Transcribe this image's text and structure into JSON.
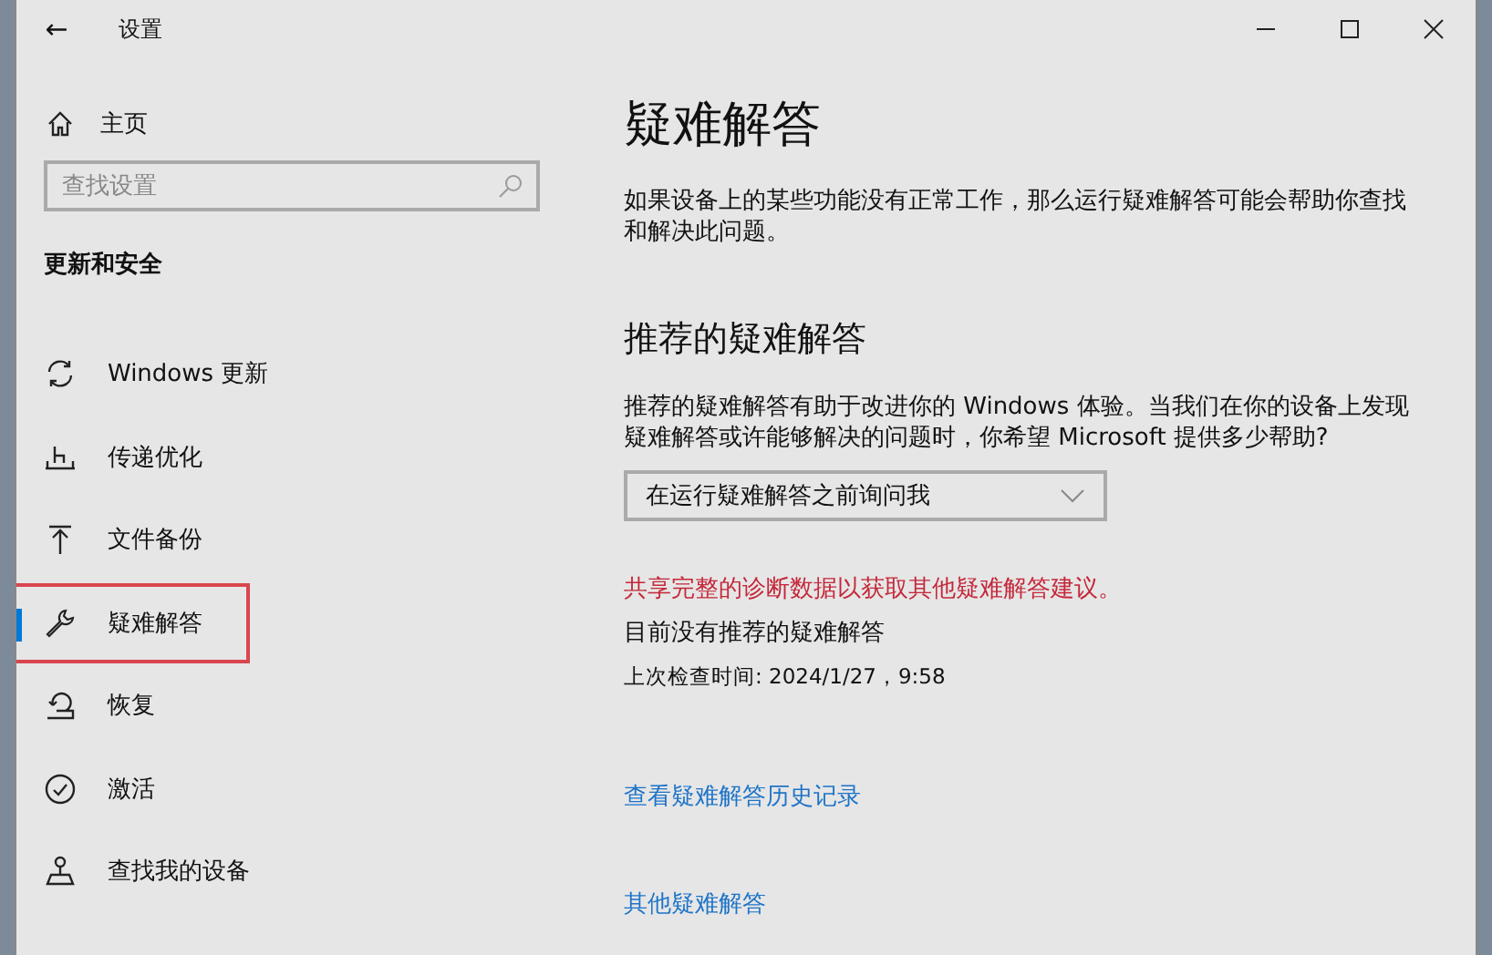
{
  "window": {
    "title": "设置",
    "back_button": "←"
  },
  "sidebar": {
    "home": "主页",
    "search": {
      "placeholder": "查找设置"
    },
    "section": "更新和安全",
    "items": [
      {
        "label": "Windows 更新",
        "selected": false,
        "highlighted": false
      },
      {
        "label": "传递优化",
        "selected": false,
        "highlighted": false
      },
      {
        "label": "文件备份",
        "selected": false,
        "highlighted": false
      },
      {
        "label": "疑难解答",
        "selected": true,
        "highlighted": true
      },
      {
        "label": "恢复",
        "selected": false,
        "highlighted": false
      },
      {
        "label": "激活",
        "selected": false,
        "highlighted": false
      },
      {
        "label": "查找我的设备",
        "selected": false,
        "highlighted": false
      }
    ]
  },
  "main": {
    "title": "疑难解答",
    "intro": "如果设备上的某些功能没有正常工作，那么运行疑难解答可能会帮助你查找和解决此问题。",
    "recommended": {
      "heading": "推荐的疑难解答",
      "description": "推荐的疑难解答有助于改进你的 Windows 体验。当我们在你的设备上发现疑难解答或许能够解决的问题时，你希望 Microsoft 提供多少帮助?",
      "dropdown_value": "在运行疑难解答之前询问我",
      "diagnostic_link": "共享完整的诊断数据以获取其他疑难解答建议。",
      "status": "目前没有推荐的疑难解答",
      "last_checked": "上次检查时间: 2024/1/27，9:58"
    },
    "history_link": "查看疑难解答历史记录",
    "other_link": "其他疑难解答"
  }
}
